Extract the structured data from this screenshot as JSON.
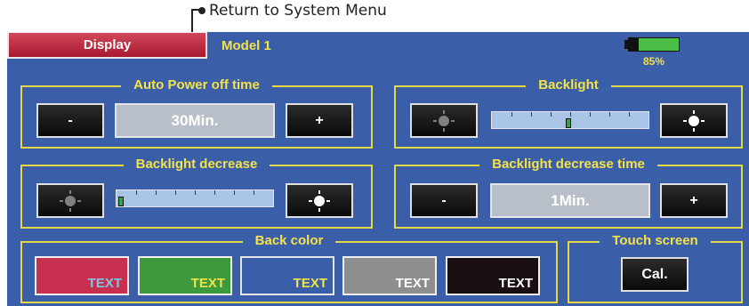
{
  "annotation": {
    "text": "Return to System Menu"
  },
  "header": {
    "display_button": "Display",
    "model_name": "Model 1",
    "battery_percent": "85%",
    "battery_level": 0.8
  },
  "auto_power_off": {
    "title": "Auto Power off time",
    "value": "30Min.",
    "minus": "-",
    "plus": "+"
  },
  "backlight": {
    "title": "Backlight",
    "level": 0.49,
    "ticks": 8
  },
  "backlight_decrease": {
    "title": "Backlight decrease",
    "level": 0.0,
    "ticks": 8
  },
  "backlight_decrease_time": {
    "title": "Backlight decrease time",
    "value": "1Min.",
    "minus": "-",
    "plus": "+"
  },
  "back_color": {
    "title": "Back color",
    "swatches": [
      {
        "label": "TEXT",
        "bg": "#c8304f",
        "fg": "#7ec4e8",
        "selected": false
      },
      {
        "label": "TEXT",
        "bg": "#3d9a3c",
        "fg": "#f0e24a",
        "selected": false
      },
      {
        "label": "TEXT",
        "bg": "#3a5fa8",
        "fg": "#f0e24a",
        "selected": true
      },
      {
        "label": "TEXT",
        "bg": "#8e8e8e",
        "fg": "#ffffff",
        "selected": false
      },
      {
        "label": "TEXT",
        "bg": "#1a0f10",
        "fg": "#ffffff",
        "selected": false
      }
    ]
  },
  "touch_screen": {
    "title": "Touch screen",
    "cal_label": "Cal."
  },
  "colors": {
    "screen_bg": "#3a5fa8",
    "accent_yellow": "#f5e24a",
    "group_border": "#e7d847"
  }
}
